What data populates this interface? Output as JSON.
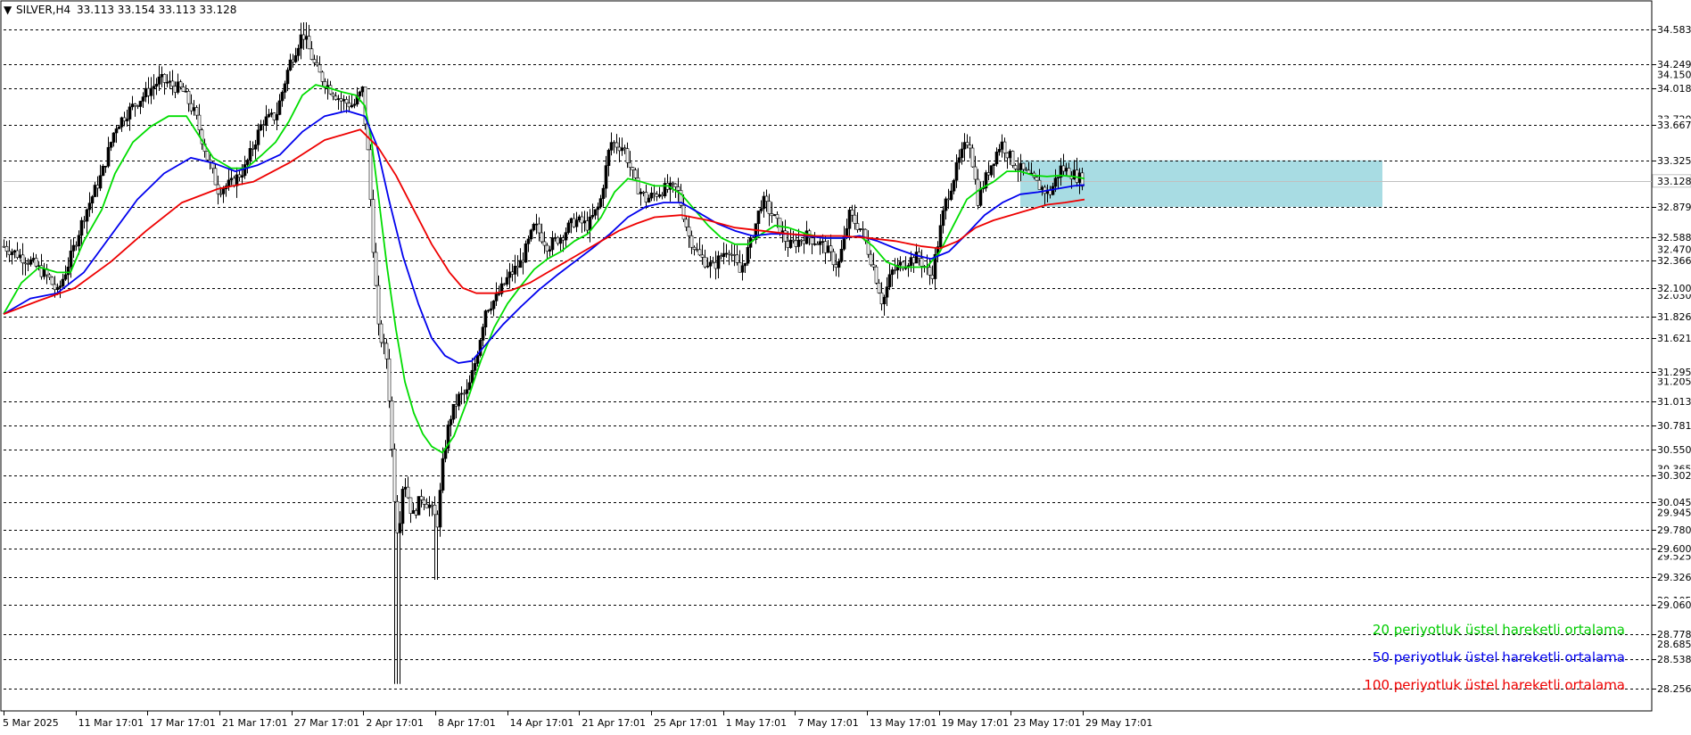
{
  "header": {
    "arrow": "▼",
    "symbol": "SILVER,H4",
    "ohlc": "33.113 33.154 33.113 33.128"
  },
  "colors": {
    "ema20": "#00dd00",
    "ema50": "#0000ee",
    "ema100": "#ee0000",
    "candle": "#000000",
    "zone": "#a8dce3",
    "gridline": "#000000"
  },
  "chart_data": {
    "type": "candlestick",
    "symbol": "SILVER",
    "timeframe": "H4",
    "ylim": [
      28.05,
      34.83
    ],
    "levels": [
      34.583,
      34.249,
      34.018,
      33.667,
      33.325,
      32.879,
      32.588,
      32.366,
      32.1,
      31.826,
      31.621,
      31.295,
      31.013,
      30.781,
      30.55,
      30.302,
      30.045,
      29.78,
      29.6,
      29.326,
      29.06,
      28.778,
      28.538,
      28.256
    ],
    "level_labels": [
      "34.583",
      "34.249",
      "34.018",
      "33.667",
      "33.325",
      "32.879",
      "32.588",
      "32.366",
      "32.100",
      "31.826",
      "31.621",
      "31.295",
      "31.013",
      "30.781",
      "30.550",
      "30.302",
      "30.045",
      "29.780",
      "29.600",
      "29.326",
      "29.060",
      "28.778",
      "28.538",
      "28.256"
    ],
    "current_price": 33.128,
    "current_price_label": "33.128",
    "small_ticks": [
      "34.150",
      "33.720",
      "32.470",
      "32.030",
      "31.205",
      "30.365",
      "29.945",
      "29.525",
      "29.105",
      "28.685"
    ],
    "x_labels": [
      "5 Mar 2025",
      "11 Mar 17:01",
      "17 Mar 17:01",
      "21 Mar 17:01",
      "27 Mar 17:01",
      "2 Apr 17:01",
      "8 Apr 17:01",
      "14 Apr 17:01",
      "21 Apr 17:01",
      "25 Apr 17:01",
      "1 May 17:01",
      "7 May 17:01",
      "13 May 17:01",
      "19 May 17:01",
      "23 May 17:01",
      "29 May 17:01"
    ],
    "price_path": [
      [
        0,
        32.5
      ],
      [
        30,
        32.35
      ],
      [
        50,
        32.2
      ],
      [
        60,
        32.05
      ],
      [
        75,
        32.4
      ],
      [
        90,
        32.8
      ],
      [
        110,
        33.2
      ],
      [
        125,
        33.65
      ],
      [
        145,
        33.85
      ],
      [
        175,
        34.1
      ],
      [
        200,
        34.0
      ],
      [
        215,
        33.75
      ],
      [
        228,
        33.35
      ],
      [
        240,
        33.05
      ],
      [
        255,
        33.1
      ],
      [
        270,
        33.25
      ],
      [
        290,
        33.7
      ],
      [
        305,
        33.75
      ],
      [
        320,
        34.25
      ],
      [
        335,
        34.55
      ],
      [
        350,
        34.2
      ],
      [
        362,
        34.05
      ],
      [
        378,
        33.9
      ],
      [
        392,
        33.85
      ],
      [
        402,
        34.0
      ],
      [
        408,
        33.4
      ],
      [
        414,
        32.5
      ],
      [
        420,
        31.7
      ],
      [
        430,
        31.4
      ],
      [
        437,
        30.2
      ],
      [
        442,
        29.7
      ],
      [
        448,
        30.3
      ],
      [
        458,
        29.9
      ],
      [
        468,
        30.1
      ],
      [
        478,
        30.0
      ],
      [
        486,
        29.85
      ],
      [
        493,
        30.5
      ],
      [
        500,
        30.85
      ],
      [
        510,
        31.05
      ],
      [
        520,
        31.1
      ],
      [
        530,
        31.45
      ],
      [
        540,
        31.9
      ],
      [
        552,
        32.0
      ],
      [
        565,
        32.2
      ],
      [
        580,
        32.35
      ],
      [
        595,
        32.7
      ],
      [
        610,
        32.5
      ],
      [
        625,
        32.6
      ],
      [
        640,
        32.75
      ],
      [
        655,
        32.7
      ],
      [
        668,
        32.9
      ],
      [
        680,
        33.5
      ],
      [
        695,
        33.45
      ],
      [
        708,
        33.1
      ],
      [
        720,
        32.95
      ],
      [
        740,
        33.05
      ],
      [
        755,
        33.05
      ],
      [
        768,
        32.6
      ],
      [
        780,
        32.4
      ],
      [
        795,
        32.3
      ],
      [
        812,
        32.5
      ],
      [
        825,
        32.25
      ],
      [
        838,
        32.55
      ],
      [
        850,
        32.95
      ],
      [
        865,
        32.75
      ],
      [
        880,
        32.5
      ],
      [
        900,
        32.6
      ],
      [
        920,
        32.5
      ],
      [
        935,
        32.3
      ],
      [
        948,
        32.8
      ],
      [
        962,
        32.65
      ],
      [
        975,
        32.3
      ],
      [
        985,
        31.95
      ],
      [
        995,
        32.25
      ],
      [
        1010,
        32.35
      ],
      [
        1025,
        32.4
      ],
      [
        1040,
        32.2
      ],
      [
        1055,
        32.9
      ],
      [
        1070,
        33.3
      ],
      [
        1082,
        33.55
      ],
      [
        1092,
        32.95
      ],
      [
        1105,
        33.25
      ],
      [
        1118,
        33.5
      ],
      [
        1132,
        33.3
      ],
      [
        1145,
        33.2
      ],
      [
        1158,
        33.1
      ],
      [
        1172,
        33.0
      ],
      [
        1185,
        33.25
      ],
      [
        1198,
        33.2
      ],
      [
        1210,
        33.13
      ]
    ],
    "series": [
      {
        "name": "20 periyotluk üstel hareketli ortalama",
        "color": "#00dd00",
        "points": [
          [
            0,
            31.85
          ],
          [
            20,
            32.15
          ],
          [
            40,
            32.3
          ],
          [
            60,
            32.25
          ],
          [
            75,
            32.25
          ],
          [
            90,
            32.55
          ],
          [
            110,
            32.85
          ],
          [
            125,
            33.2
          ],
          [
            145,
            33.5
          ],
          [
            165,
            33.65
          ],
          [
            185,
            33.75
          ],
          [
            205,
            33.75
          ],
          [
            220,
            33.55
          ],
          [
            235,
            33.35
          ],
          [
            255,
            33.25
          ],
          [
            272,
            33.25
          ],
          [
            290,
            33.38
          ],
          [
            305,
            33.5
          ],
          [
            320,
            33.7
          ],
          [
            335,
            33.95
          ],
          [
            350,
            34.05
          ],
          [
            365,
            34.02
          ],
          [
            380,
            33.98
          ],
          [
            395,
            33.95
          ],
          [
            405,
            33.85
          ],
          [
            412,
            33.55
          ],
          [
            420,
            33.0
          ],
          [
            430,
            32.3
          ],
          [
            440,
            31.7
          ],
          [
            450,
            31.2
          ],
          [
            460,
            30.9
          ],
          [
            470,
            30.7
          ],
          [
            480,
            30.58
          ],
          [
            492,
            30.52
          ],
          [
            505,
            30.68
          ],
          [
            520,
            31.02
          ],
          [
            535,
            31.4
          ],
          [
            550,
            31.72
          ],
          [
            565,
            31.95
          ],
          [
            580,
            32.12
          ],
          [
            595,
            32.28
          ],
          [
            610,
            32.38
          ],
          [
            625,
            32.45
          ],
          [
            640,
            32.55
          ],
          [
            655,
            32.62
          ],
          [
            670,
            32.78
          ],
          [
            685,
            33.02
          ],
          [
            700,
            33.15
          ],
          [
            715,
            33.12
          ],
          [
            730,
            33.08
          ],
          [
            745,
            33.08
          ],
          [
            760,
            33.0
          ],
          [
            775,
            32.85
          ],
          [
            790,
            32.7
          ],
          [
            805,
            32.58
          ],
          [
            820,
            32.52
          ],
          [
            835,
            32.52
          ],
          [
            850,
            32.62
          ],
          [
            865,
            32.7
          ],
          [
            880,
            32.68
          ],
          [
            900,
            32.62
          ],
          [
            920,
            32.58
          ],
          [
            940,
            32.58
          ],
          [
            960,
            32.6
          ],
          [
            975,
            32.5
          ],
          [
            990,
            32.35
          ],
          [
            1005,
            32.3
          ],
          [
            1020,
            32.3
          ],
          [
            1035,
            32.3
          ],
          [
            1050,
            32.45
          ],
          [
            1065,
            32.7
          ],
          [
            1080,
            32.95
          ],
          [
            1095,
            33.05
          ],
          [
            1110,
            33.12
          ],
          [
            1125,
            33.22
          ],
          [
            1140,
            33.22
          ],
          [
            1155,
            33.18
          ],
          [
            1170,
            33.17
          ],
          [
            1185,
            33.18
          ],
          [
            1200,
            33.17
          ],
          [
            1212,
            33.15
          ]
        ]
      },
      {
        "name": "50 periyotluk üstel hareketli ortalama",
        "color": "#0000ee",
        "points": [
          [
            0,
            31.85
          ],
          [
            30,
            32.0
          ],
          [
            60,
            32.05
          ],
          [
            90,
            32.25
          ],
          [
            120,
            32.6
          ],
          [
            150,
            32.95
          ],
          [
            180,
            33.2
          ],
          [
            210,
            33.35
          ],
          [
            235,
            33.3
          ],
          [
            260,
            33.22
          ],
          [
            285,
            33.28
          ],
          [
            310,
            33.38
          ],
          [
            335,
            33.6
          ],
          [
            360,
            33.75
          ],
          [
            385,
            33.8
          ],
          [
            405,
            33.75
          ],
          [
            418,
            33.48
          ],
          [
            432,
            32.95
          ],
          [
            448,
            32.4
          ],
          [
            465,
            31.95
          ],
          [
            480,
            31.62
          ],
          [
            495,
            31.45
          ],
          [
            510,
            31.38
          ],
          [
            525,
            31.4
          ],
          [
            540,
            31.55
          ],
          [
            560,
            31.75
          ],
          [
            580,
            31.92
          ],
          [
            600,
            32.08
          ],
          [
            620,
            32.22
          ],
          [
            640,
            32.35
          ],
          [
            660,
            32.48
          ],
          [
            680,
            32.62
          ],
          [
            700,
            32.78
          ],
          [
            720,
            32.88
          ],
          [
            740,
            32.92
          ],
          [
            760,
            32.92
          ],
          [
            780,
            32.82
          ],
          [
            800,
            32.72
          ],
          [
            820,
            32.65
          ],
          [
            840,
            32.6
          ],
          [
            860,
            32.62
          ],
          [
            880,
            32.62
          ],
          [
            900,
            32.6
          ],
          [
            920,
            32.58
          ],
          [
            940,
            32.58
          ],
          [
            960,
            32.6
          ],
          [
            980,
            32.55
          ],
          [
            1000,
            32.48
          ],
          [
            1020,
            32.42
          ],
          [
            1040,
            32.38
          ],
          [
            1060,
            32.45
          ],
          [
            1080,
            32.62
          ],
          [
            1100,
            32.8
          ],
          [
            1120,
            32.92
          ],
          [
            1140,
            33.0
          ],
          [
            1160,
            33.02
          ],
          [
            1180,
            33.05
          ],
          [
            1200,
            33.08
          ],
          [
            1212,
            33.09
          ]
        ]
      },
      {
        "name": "100 periyotluk üstel hareketli ortalama",
        "color": "#ee0000",
        "points": [
          [
            0,
            31.85
          ],
          [
            40,
            31.98
          ],
          [
            80,
            32.1
          ],
          [
            120,
            32.35
          ],
          [
            160,
            32.65
          ],
          [
            200,
            32.92
          ],
          [
            240,
            33.05
          ],
          [
            280,
            33.12
          ],
          [
            320,
            33.3
          ],
          [
            360,
            33.52
          ],
          [
            400,
            33.62
          ],
          [
            420,
            33.45
          ],
          [
            440,
            33.18
          ],
          [
            460,
            32.85
          ],
          [
            480,
            32.52
          ],
          [
            500,
            32.25
          ],
          [
            515,
            32.1
          ],
          [
            530,
            32.05
          ],
          [
            550,
            32.05
          ],
          [
            570,
            32.08
          ],
          [
            590,
            32.15
          ],
          [
            610,
            32.25
          ],
          [
            630,
            32.35
          ],
          [
            650,
            32.45
          ],
          [
            670,
            32.55
          ],
          [
            690,
            32.65
          ],
          [
            710,
            32.72
          ],
          [
            730,
            32.78
          ],
          [
            760,
            32.8
          ],
          [
            790,
            32.75
          ],
          [
            820,
            32.68
          ],
          [
            850,
            32.65
          ],
          [
            880,
            32.62
          ],
          [
            910,
            32.6
          ],
          [
            940,
            32.6
          ],
          [
            970,
            32.58
          ],
          [
            1000,
            32.55
          ],
          [
            1030,
            32.5
          ],
          [
            1050,
            32.48
          ],
          [
            1070,
            32.55
          ],
          [
            1090,
            32.68
          ],
          [
            1110,
            32.75
          ],
          [
            1130,
            32.8
          ],
          [
            1150,
            32.85
          ],
          [
            1170,
            32.9
          ],
          [
            1190,
            32.92
          ],
          [
            1212,
            32.95
          ]
        ]
      }
    ],
    "zone": {
      "from": 32.879,
      "to": 33.325
    }
  },
  "legend": {
    "ema20": "20 periyotluk üstel hareketli ortalama",
    "ema50": "50 periyotluk üstel hareketli ortalama",
    "ema100": "100 periyotluk üstel hareketli ortalama"
  }
}
